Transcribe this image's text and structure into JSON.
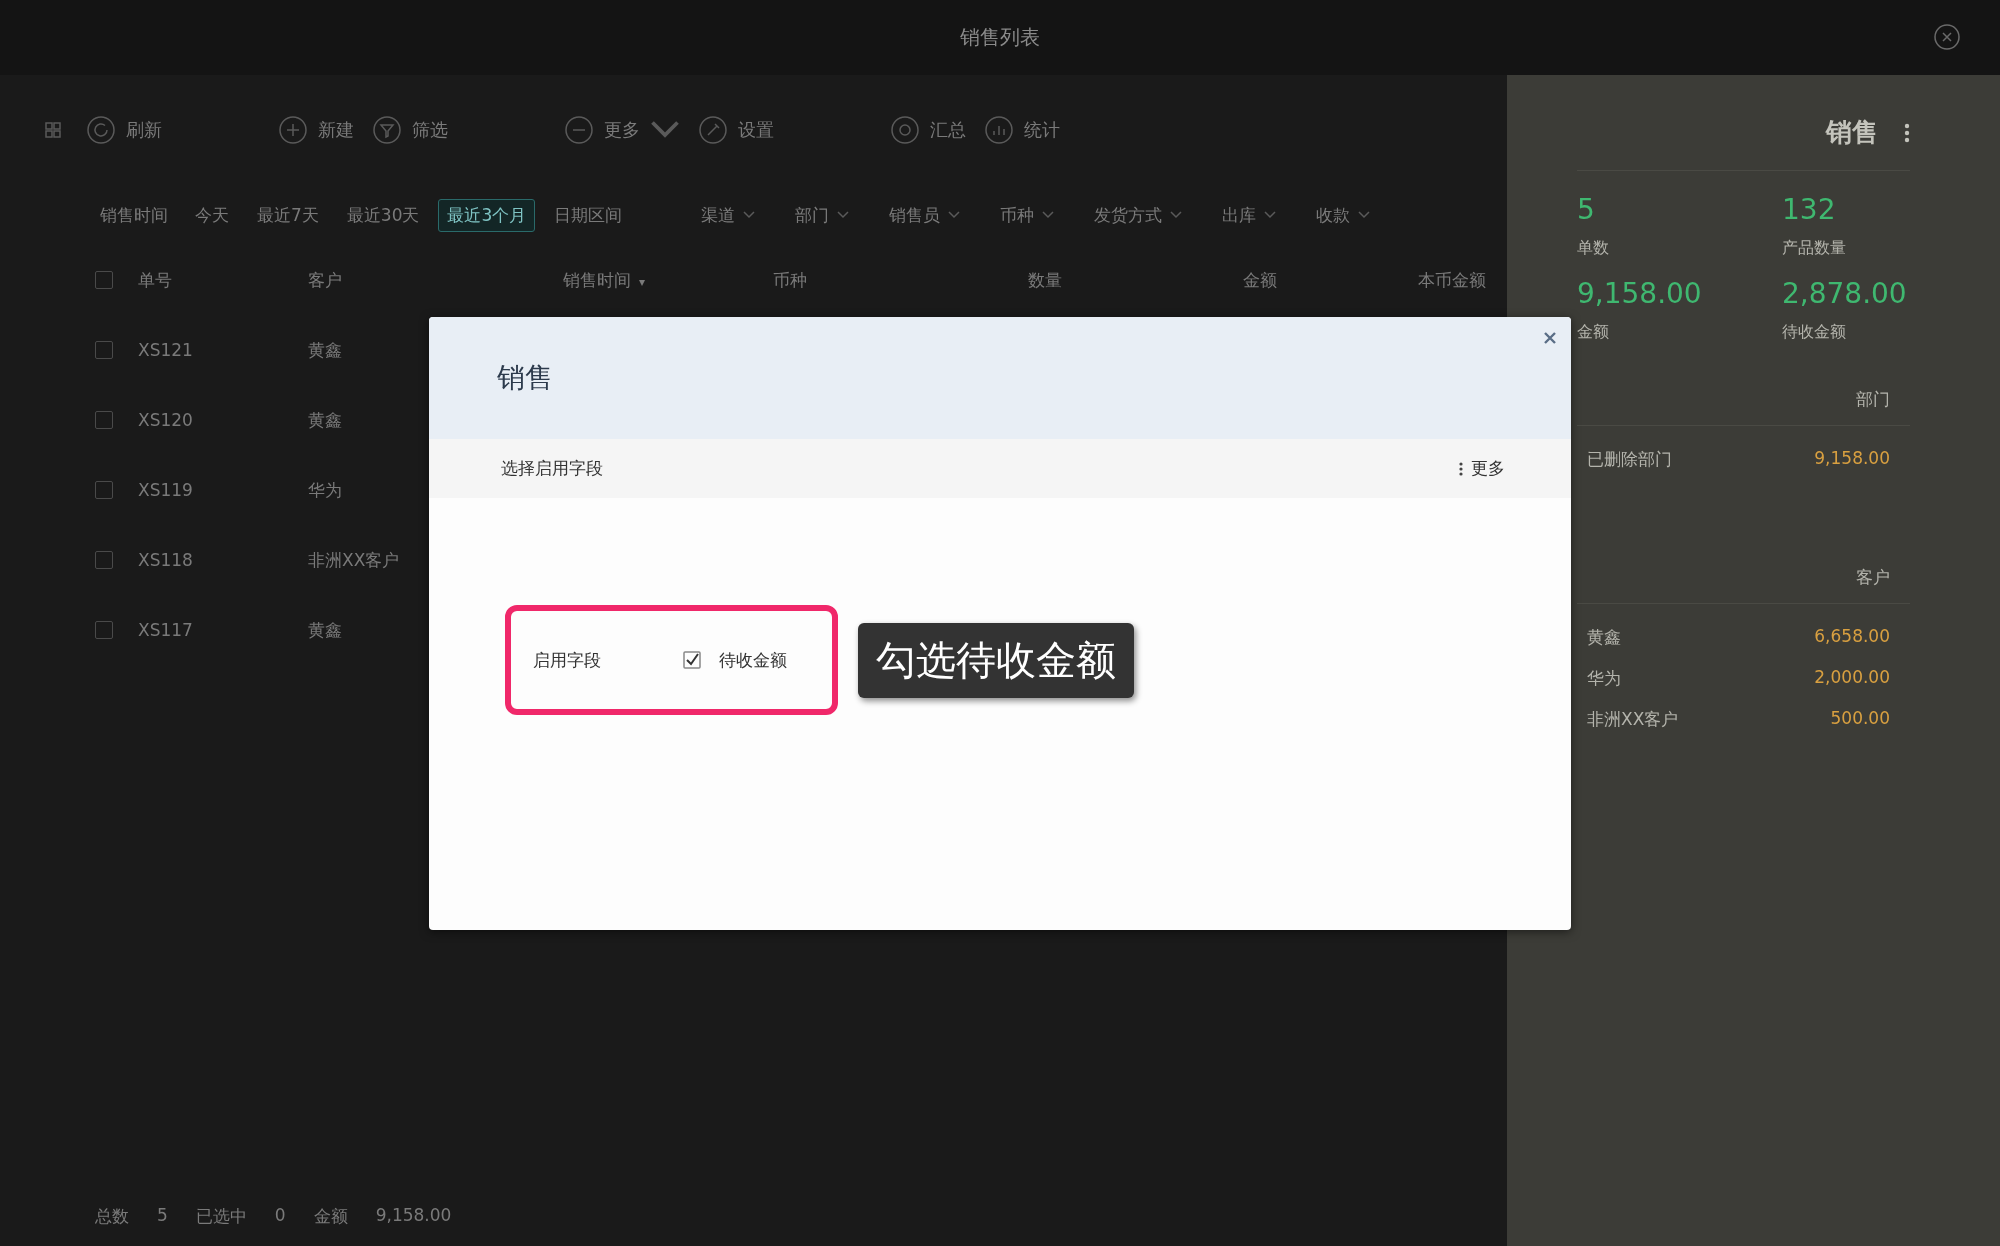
{
  "window": {
    "title": "销售列表"
  },
  "toolbar": [
    {
      "kind": "grid"
    },
    {
      "kind": "refresh",
      "label": "刷新"
    },
    {
      "kind": "add",
      "label": "新建"
    },
    {
      "kind": "filter",
      "label": "筛选"
    },
    {
      "kind": "more",
      "label": "更多"
    },
    {
      "kind": "settings",
      "label": "设置"
    },
    {
      "kind": "summary",
      "label": "汇总"
    },
    {
      "kind": "stats",
      "label": "统计"
    }
  ],
  "filters": {
    "label": "销售时间",
    "ranges": [
      {
        "label": "今天",
        "selected": false
      },
      {
        "label": "最近7天",
        "selected": false
      },
      {
        "label": "最近30天",
        "selected": false
      },
      {
        "label": "最近3个月",
        "selected": true
      },
      {
        "label": "日期区间",
        "selected": false
      }
    ],
    "dropdowns": [
      "渠道",
      "部门",
      "销售员",
      "币种",
      "发货方式",
      "出库",
      "收款"
    ]
  },
  "table": {
    "columns": [
      {
        "label": "单号"
      },
      {
        "label": "客户"
      },
      {
        "label": "销售时间",
        "sort": "▾"
      },
      {
        "label": "币种"
      },
      {
        "label": "数量"
      },
      {
        "label": "金额"
      },
      {
        "label": "本币金额"
      }
    ],
    "header_checked": false,
    "rows": [
      {
        "checked": false,
        "cells": [
          "XS121",
          "黄鑫"
        ]
      },
      {
        "checked": false,
        "cells": [
          "XS120",
          "黄鑫"
        ]
      },
      {
        "checked": false,
        "cells": [
          "XS119",
          "华为"
        ]
      },
      {
        "checked": false,
        "cells": [
          "XS118",
          "非洲XX客户"
        ]
      },
      {
        "checked": false,
        "cells": [
          "XS117",
          "黄鑫"
        ]
      }
    ]
  },
  "footer": [
    {
      "label": "总数",
      "value": "5"
    },
    {
      "label": "已选中",
      "value": "0"
    },
    {
      "label": "金额",
      "value": "9,158.00"
    }
  ],
  "summary_panel": {
    "title": "销售",
    "stats": [
      {
        "value": "5",
        "label": "单数"
      },
      {
        "value": "132",
        "label": "产品数量"
      },
      {
        "value": "9,158.00",
        "label": "金额"
      },
      {
        "value": "2,878.00",
        "label": "待收金额"
      }
    ],
    "sections": [
      {
        "title": "部门",
        "rows": [
          {
            "name": "已删除部门",
            "amount": "9,158.00"
          }
        ]
      },
      {
        "title": "客户",
        "rows": [
          {
            "name": "黄鑫",
            "amount": "6,658.00"
          },
          {
            "name": "华为",
            "amount": "2,000.00"
          },
          {
            "name": "非洲XX客户",
            "amount": "500.00"
          }
        ]
      }
    ]
  },
  "dialog": {
    "title": "销售",
    "toolbar_label": "选择启用字段",
    "more": "更多",
    "field_label": "启用字段",
    "option": {
      "label": "待收金额",
      "checked": true
    },
    "callout": "勾选待收金额"
  }
}
